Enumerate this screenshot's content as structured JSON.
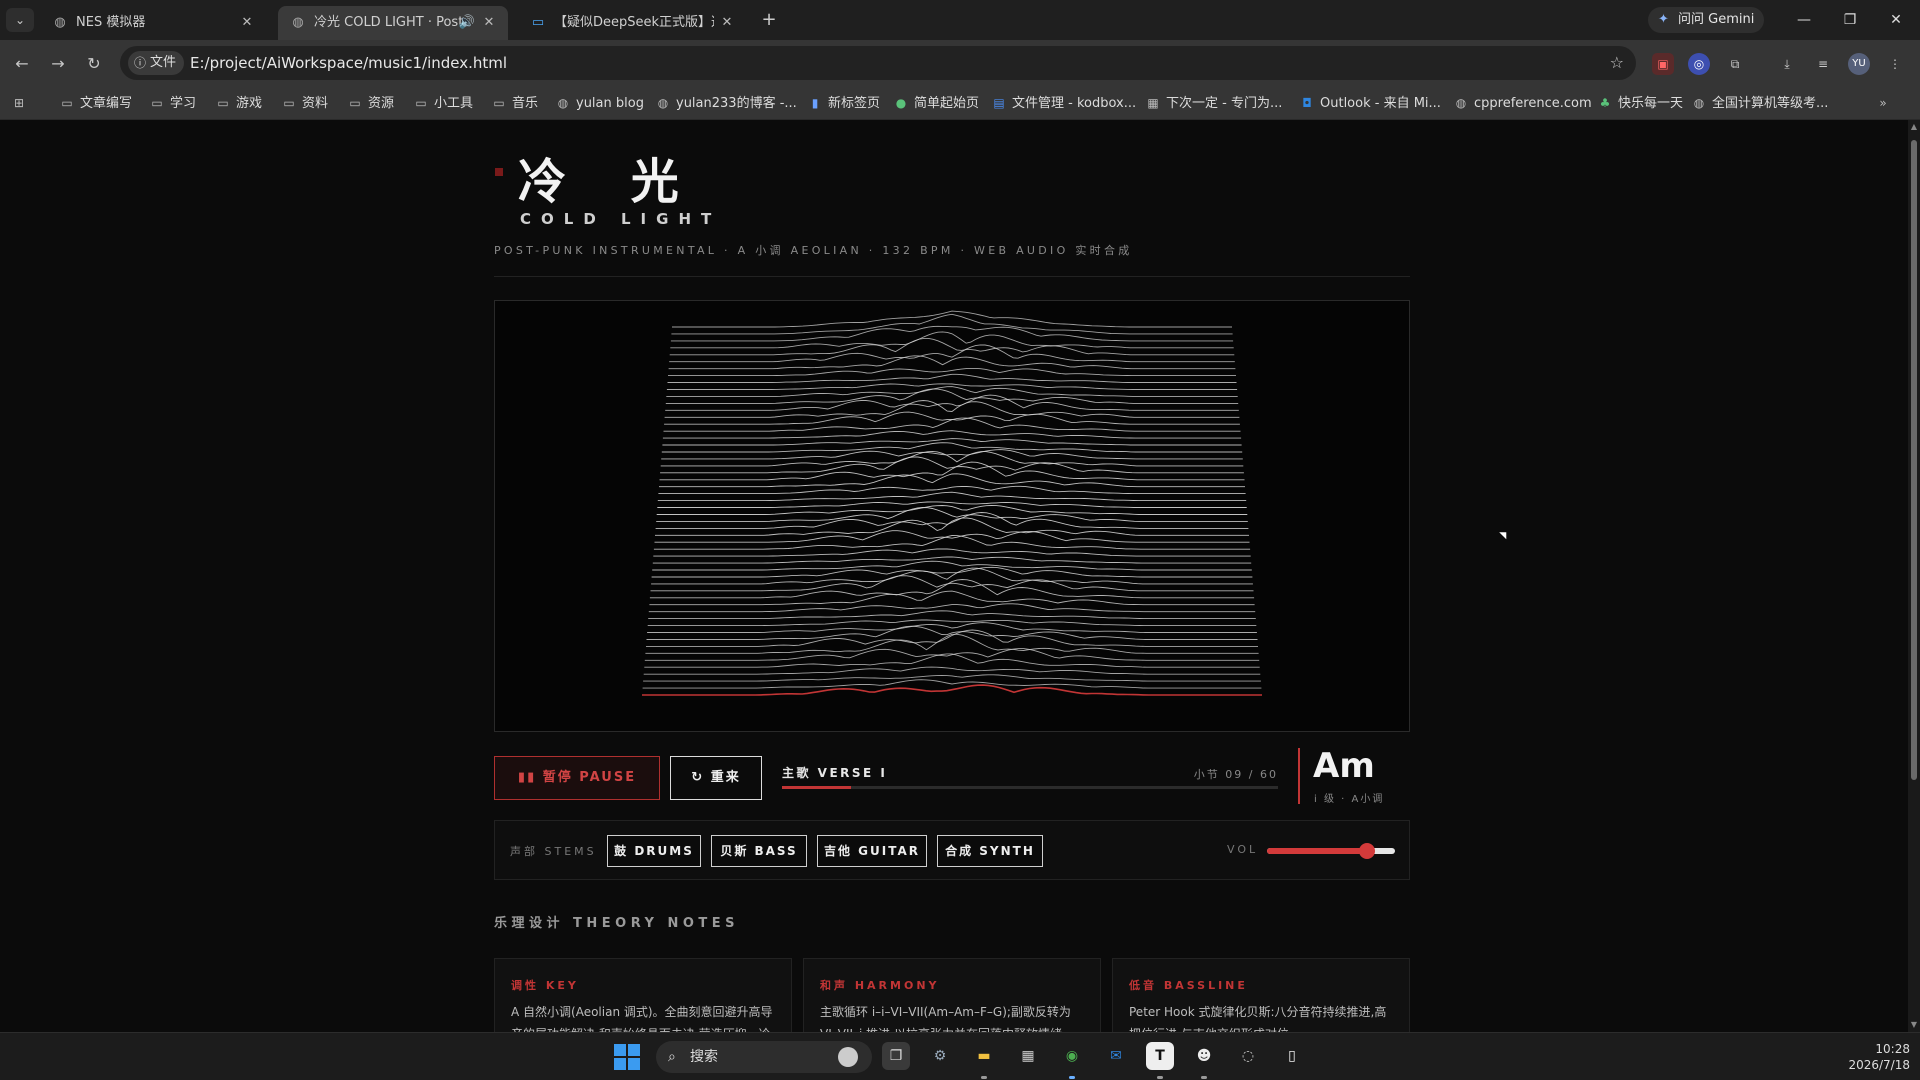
{
  "browser": {
    "tabs": [
      {
        "title": "NES 模拟器",
        "active": false
      },
      {
        "title": "冷光 COLD LIGHT · Post-P",
        "active": true,
        "audio": true
      },
      {
        "title": "【疑似DeepSeek正式版】这才",
        "active": false
      }
    ],
    "gemini_label": "问问 Gemini",
    "site_info_label": "文件",
    "url": "E:/project/AiWorkspace/music1/index.html",
    "profile_initials": "YU",
    "bookmarks": [
      {
        "label": "文章编写",
        "icon": "folder-icon"
      },
      {
        "label": "学习",
        "icon": "folder-icon"
      },
      {
        "label": "游戏",
        "icon": "folder-icon"
      },
      {
        "label": "资料",
        "icon": "folder-icon"
      },
      {
        "label": "资源",
        "icon": "folder-icon"
      },
      {
        "label": "小工具",
        "icon": "folder-icon"
      },
      {
        "label": "音乐",
        "icon": "folder-icon"
      },
      {
        "label": "yulan blog",
        "icon": "globe-icon"
      },
      {
        "label": "yulan233的博客 -...",
        "icon": "globe-icon"
      },
      {
        "label": "新标签页",
        "icon": "page-icon"
      },
      {
        "label": "简单起始页",
        "icon": "circle-icon"
      },
      {
        "label": "文件管理 - kodbox...",
        "icon": "kod-icon"
      },
      {
        "label": "下次一定 - 专门为...",
        "icon": "page-icon"
      },
      {
        "label": "Outlook - 来自 Mi...",
        "icon": "outlook-icon"
      },
      {
        "label": "cppreference.com",
        "icon": "globe-icon"
      },
      {
        "label": "快乐每一天",
        "icon": "leaf-icon"
      },
      {
        "label": "全国计算机等级考...",
        "icon": "globe-icon"
      }
    ]
  },
  "page": {
    "title_cn": "冷 光",
    "title_en": "COLD LIGHT",
    "subtitle": "POST-PUNK INSTRUMENTAL · A 小调 AEOLIAN · 132 BPM · WEB AUDIO 实时合成",
    "controls": {
      "pause_label": "▮▮ 暂停 PAUSE",
      "restart_label": "↻ 重来",
      "section": "主歌 VERSE I",
      "bar_counter": "小节 09 / 60",
      "progress": 0.14
    },
    "chord": {
      "name": "Am",
      "sub": "i 级 · A小调"
    },
    "stems": {
      "label": "声部 STEMS",
      "buttons": [
        "鼓 DRUMS",
        "贝斯 BASS",
        "吉他 GUITAR",
        "合成 SYNTH"
      ],
      "vol_label": "VOL",
      "volume": 0.78
    },
    "theory": {
      "heading": "乐理设计 THEORY NOTES",
      "cards": [
        {
          "title": "调性 KEY",
          "body": "A 自然小调(Aeolian 调式)。全曲刻意回避升高导音的属功能解决,和声始终悬而未决,营造压抑、冷峻的后朋克气质。"
        },
        {
          "title": "和声 HARMONY",
          "body": "主歌循环 i–i–VI–VII(Am–Am–F–G);副歌反转为 VI–VII–i 推进,以拉高张力并在回落中释放情绪。"
        },
        {
          "title": "低音 BASSLINE",
          "body": "Peter Hook 式旋律化贝斯:八分音符持续推进,高把位行进,与吉他交织形成对位。"
        }
      ]
    }
  },
  "colors": {
    "accent": "#c23535",
    "background": "#0b0b0b",
    "panel": "#111111"
  },
  "taskbar": {
    "search_label": "搜索",
    "time": "10:28",
    "date": "2026/7/18"
  }
}
